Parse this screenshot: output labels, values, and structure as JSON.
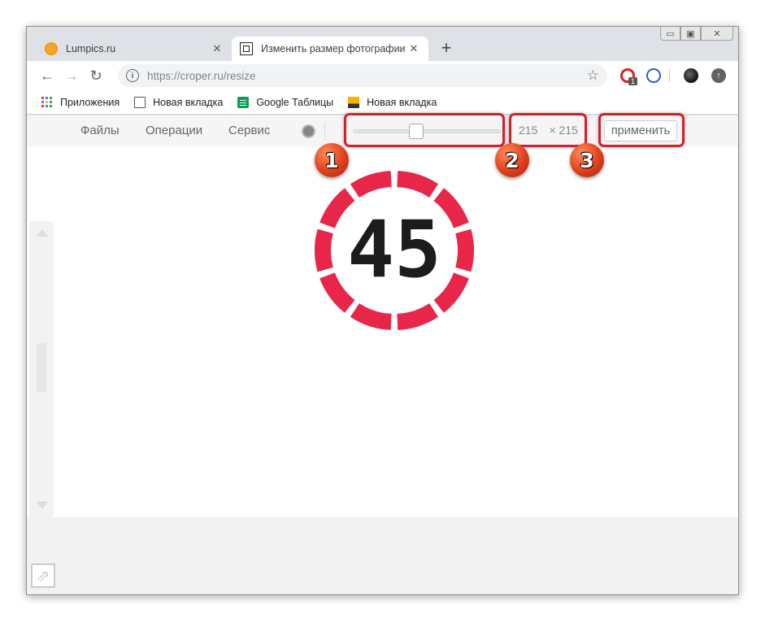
{
  "browser": {
    "tabs": [
      {
        "title": "Lumpics.ru",
        "favicon": "orange-circle-icon",
        "active": false
      },
      {
        "title": "Изменить размер фотографии",
        "favicon": "crop-icon",
        "active": true
      }
    ],
    "new_tab_label": "+",
    "window_controls": {
      "minimize": "▭",
      "maximize": "▣",
      "close": "✕"
    },
    "address": {
      "scheme_host": "https://croper.ru",
      "path": "/resize"
    },
    "extensions": {
      "opera_badge": "1"
    }
  },
  "bookmarks": [
    {
      "label": "Приложения",
      "icon": "apps-grid-icon"
    },
    {
      "label": "Новая вкладка",
      "icon": "page-icon"
    },
    {
      "label": "Google Таблицы",
      "icon": "sheets-icon"
    },
    {
      "label": "Новая вкладка",
      "icon": "image-icon"
    }
  ],
  "site_menu": {
    "items": [
      "Файлы",
      "Операции",
      "Сервис"
    ],
    "size": {
      "width": "215",
      "height": "× 215"
    },
    "apply_label": "применить",
    "slider_level": 0.42
  },
  "markers": [
    "1",
    "2",
    "3"
  ],
  "image": {
    "number": "45",
    "ring_color": "#e8264a",
    "digit_color": "#1c1c1c"
  },
  "colors": {
    "highlight": "#d2202f"
  }
}
